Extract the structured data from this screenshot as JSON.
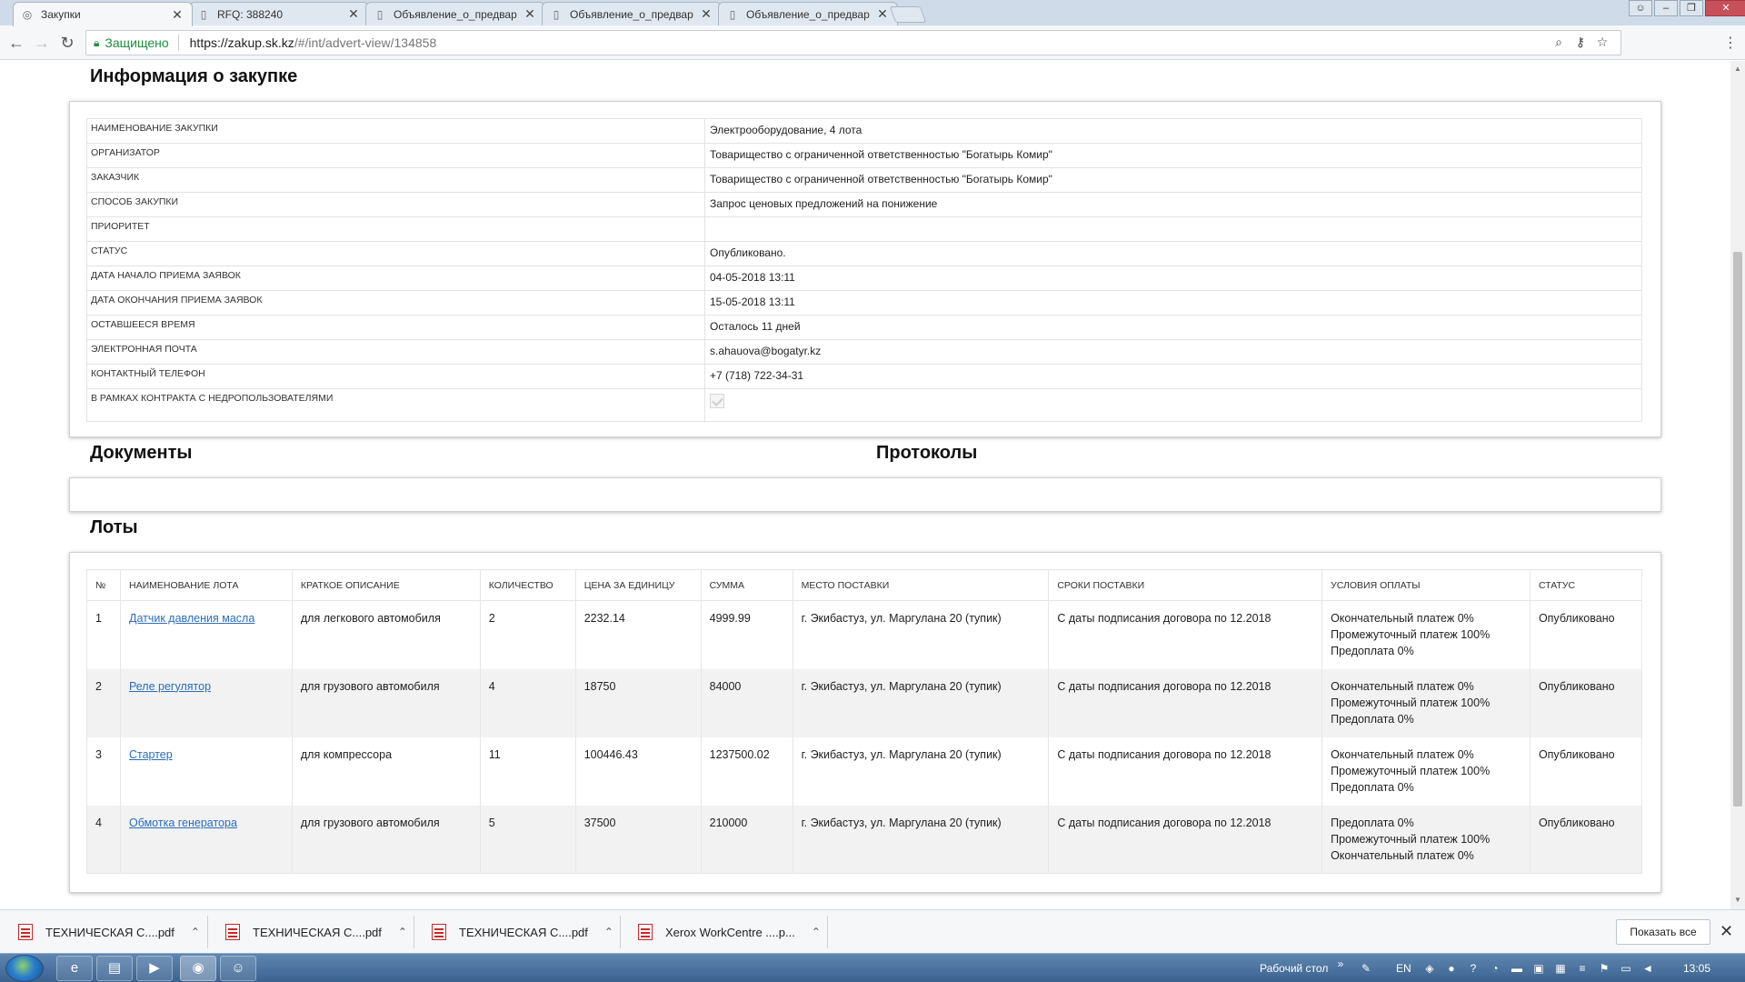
{
  "browser": {
    "tabs": [
      {
        "title": "Закупки",
        "active": true
      },
      {
        "title": "RFQ: 388240",
        "active": false
      },
      {
        "title": "Объявление_о_предвар",
        "active": false
      },
      {
        "title": "Объявление_о_предвар",
        "active": false
      },
      {
        "title": "Объявление_о_предвар",
        "active": false
      }
    ],
    "secure_label": "Защищено",
    "url_host": "https://zakup.sk.kz",
    "url_path": "/#/int/advert-view/134858"
  },
  "info": {
    "title": "Информация о закупке",
    "rows": [
      {
        "label": "НАИМЕНОВАНИЕ ЗАКУПКИ",
        "value": "Электрооборудование, 4 лота"
      },
      {
        "label": "ОРГАНИЗАТОР",
        "value": "Товарищество с ограниченной ответственностью \"Богатырь Комир\""
      },
      {
        "label": "ЗАКАЗЧИК",
        "value": "Товарищество с ограниченной ответственностью \"Богатырь Комир\""
      },
      {
        "label": "СПОСОБ ЗАКУПКИ",
        "value": "Запрос ценовых предложений на понижение"
      },
      {
        "label": "ПРИОРИТЕТ",
        "value": ""
      },
      {
        "label": "СТАТУС",
        "value": "Опубликовано."
      },
      {
        "label": "ДАТА НАЧАЛО ПРИЕМА ЗАЯВОК",
        "value": "04-05-2018 13:11"
      },
      {
        "label": "ДАТА ОКОНЧАНИЯ ПРИЕМА ЗАЯВОК",
        "value": "15-05-2018 13:11"
      },
      {
        "label": "ОСТАВШЕЕСЯ ВРЕМЯ",
        "value": "Осталось 11 дней"
      },
      {
        "label": "ЭЛЕКТРОННАЯ ПОЧТА",
        "value": "s.ahauova@bogatyr.kz"
      },
      {
        "label": "КОНТАКТНЫЙ ТЕЛЕФОН",
        "value": "+7 (718) 722-34-31"
      },
      {
        "label": "В РАМКАХ КОНТРАКТА С НЕДРОПОЛЬЗОВАТЕЛЯМИ",
        "value": ""
      }
    ]
  },
  "documents_title": "Документы",
  "protocols_title": "Протоколы",
  "lots": {
    "title": "Лоты",
    "headers": [
      "№",
      "НАИМЕНОВАНИЕ ЛОТА",
      "КРАТКОЕ ОПИСАНИЕ",
      "КОЛИЧЕСТВО",
      "ЦЕНА ЗА ЕДИНИЦУ",
      "СУММА",
      "МЕСТО ПОСТАВКИ",
      "СРОКИ ПОСТАВКИ",
      "УСЛОВИЯ ОПЛАТЫ",
      "СТАТУС"
    ],
    "rows": [
      {
        "num": "1",
        "name": "Датчик давления масла",
        "desc": "для легкового автомобиля",
        "qty": "2",
        "price": "2232.14",
        "sum": "4999.99",
        "place": "г. Экибастуз, ул. Маргулана 20 (тупик)",
        "term": "С даты подписания договора по 12.2018",
        "pay1": "Окончательный платеж 0%",
        "pay2": "Промежуточный платеж 100%",
        "pay3": "Предоплата 0%",
        "status": "Опубликовано"
      },
      {
        "num": "2",
        "name": "Реле регулятор",
        "desc": "для грузового автомобиля",
        "qty": "4",
        "price": "18750",
        "sum": "84000",
        "place": "г. Экибастуз, ул. Маргулана 20 (тупик)",
        "term": "С даты подписания договора по 12.2018",
        "pay1": "Окончательный платеж 0%",
        "pay2": "Промежуточный платеж 100%",
        "pay3": "Предоплата 0%",
        "status": "Опубликовано"
      },
      {
        "num": "3",
        "name": "Стартер",
        "desc": "для компрессора",
        "qty": "11",
        "price": "100446.43",
        "sum": "1237500.02",
        "place": "г. Экибастуз, ул. Маргулана 20 (тупик)",
        "term": "С даты подписания договора по 12.2018",
        "pay1": "Окончательный платеж 0%",
        "pay2": "Промежуточный платеж 100%",
        "pay3": "Предоплата 0%",
        "status": "Опубликовано"
      },
      {
        "num": "4",
        "name": "Обмотка генератора",
        "desc": "для грузового автомобиля",
        "qty": "5",
        "price": "37500",
        "sum": "210000",
        "place": "г. Экибастуз, ул. Маргулана 20 (тупик)",
        "term": "С даты подписания договора по 12.2018",
        "pay1": "Предоплата 0%",
        "pay2": "Промежуточный платеж 100%",
        "pay3": "Окончательный платеж 0%",
        "status": "Опубликовано"
      }
    ]
  },
  "downloads": {
    "items": [
      {
        "name": "ТЕХНИЧЕСКАЯ   С....pdf"
      },
      {
        "name": "ТЕХНИЧЕСКАЯ   С....pdf"
      },
      {
        "name": "ТЕХНИЧЕСКАЯ   С....pdf"
      },
      {
        "name": "Xerox WorkCentre ....p..."
      }
    ],
    "show_all": "Показать все"
  },
  "taskbar": {
    "desktop_label": "Рабочий стол",
    "lang": "EN",
    "time": "13:05"
  }
}
